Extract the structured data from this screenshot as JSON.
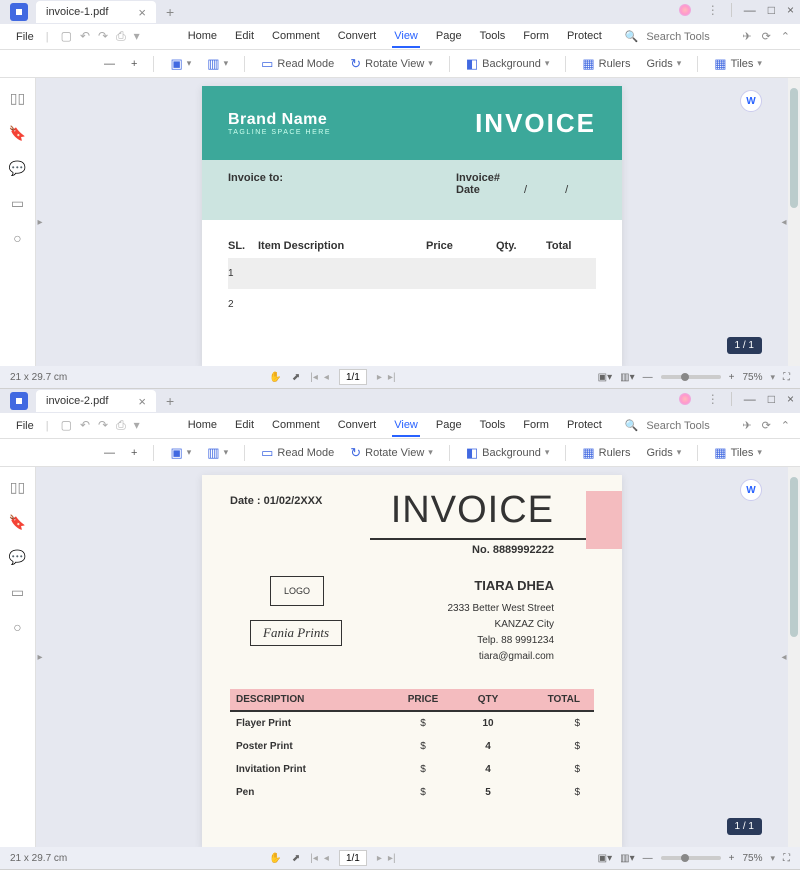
{
  "windows": [
    {
      "tab_name": "invoice-1.pdf",
      "file_label": "File",
      "menu": [
        "Home",
        "Edit",
        "Comment",
        "Convert",
        "View",
        "Page",
        "Tools",
        "Form",
        "Protect"
      ],
      "active_menu": "View",
      "search_placeholder": "Search Tools",
      "toolbar": {
        "read_mode": "Read Mode",
        "rotate": "Rotate View",
        "background": "Background",
        "rulers": "Rulers",
        "grids": "Grids",
        "tiles": "Tiles"
      },
      "page_badge": "1 / 1",
      "status": {
        "dim": "21 x 29.7 cm",
        "page": "1/1",
        "zoom": "75%"
      }
    },
    {
      "tab_name": "invoice-2.pdf",
      "file_label": "File",
      "menu": [
        "Home",
        "Edit",
        "Comment",
        "Convert",
        "View",
        "Page",
        "Tools",
        "Form",
        "Protect"
      ],
      "active_menu": "View",
      "search_placeholder": "Search Tools",
      "toolbar": {
        "read_mode": "Read Mode",
        "rotate": "Rotate View",
        "background": "Background",
        "rulers": "Rulers",
        "grids": "Grids",
        "tiles": "Tiles"
      },
      "page_badge": "1 / 1",
      "status": {
        "dim": "21 x 29.7 cm",
        "page": "1/1",
        "zoom": "75%"
      }
    }
  ],
  "invoice1": {
    "brand": "Brand Name",
    "tagline": "TAGLINE SPACE HERE",
    "title": "INVOICE",
    "to_label": "Invoice to:",
    "num_label": "Invoice#",
    "date_label": "Date",
    "date_sep": "/",
    "cols": {
      "sl": "SL.",
      "desc": "Item Description",
      "price": "Price",
      "qty": "Qty.",
      "total": "Total"
    },
    "rows": [
      "1",
      "2"
    ]
  },
  "invoice2": {
    "date_label": "Date : 01/02/2XXX",
    "title": "INVOICE",
    "no_label": "No. 8889992222",
    "logo": "LOGO",
    "company": "Fania Prints",
    "contact": {
      "name": "TIARA DHEA",
      "addr1": "2333 Better West Street",
      "addr2": "KANZAZ City",
      "tel": "Telp. 88 9991234",
      "email": "tiara@gmail.com"
    },
    "cols": {
      "desc": "DESCRIPTION",
      "price": "PRICE",
      "qty": "QTY",
      "total": "TOTAL"
    },
    "items": [
      {
        "desc": "Flayer Print",
        "price": "$",
        "qty": "10",
        "total": "$"
      },
      {
        "desc": "Poster Print",
        "price": "$",
        "qty": "4",
        "total": "$"
      },
      {
        "desc": "Invitation Print",
        "price": "$",
        "qty": "4",
        "total": "$"
      },
      {
        "desc": "Pen",
        "price": "$",
        "qty": "5",
        "total": "$"
      }
    ]
  }
}
